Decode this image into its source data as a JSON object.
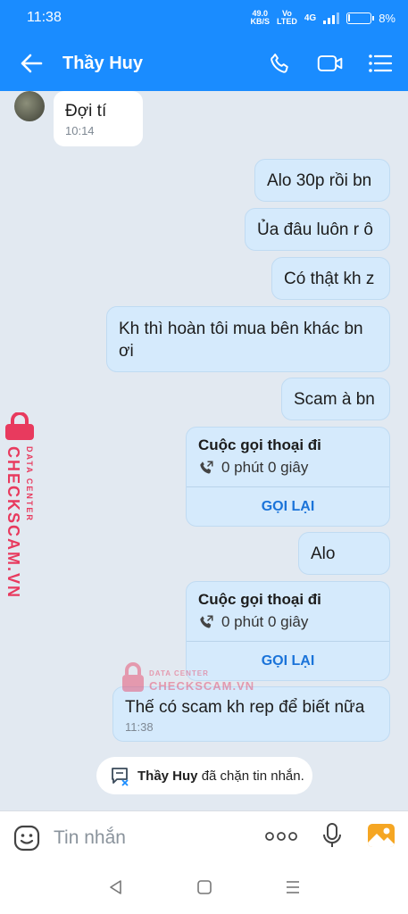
{
  "status_bar": {
    "time": "11:38",
    "speed_value": "49.0",
    "speed_unit": "KB/S",
    "net_top": "Vo",
    "net_bottom": "LTED",
    "network_type": "4G",
    "battery": "8%",
    "battery_level": 0.08
  },
  "header": {
    "title": "Thầy Huy",
    "back_icon": "arrow-left-icon",
    "actions": [
      "phone-icon",
      "video-call-icon",
      "menu-icon"
    ]
  },
  "messages": [
    {
      "id": "m1",
      "direction": "incoming",
      "text": "Đợi tí",
      "time": "10:14"
    },
    {
      "id": "m2",
      "direction": "outgoing",
      "text": "Alo 30p rồi bn"
    },
    {
      "id": "m3",
      "direction": "outgoing",
      "text": "Ủa đâu luôn r ô"
    },
    {
      "id": "m4",
      "direction": "outgoing",
      "text": "Có thật kh z"
    },
    {
      "id": "m5",
      "direction": "outgoing",
      "text": "Kh thì hoàn tôi mua bên khác bn ơi"
    },
    {
      "id": "m6",
      "direction": "outgoing",
      "text": "Scam à bn"
    },
    {
      "id": "m7",
      "direction": "outgoing",
      "type": "call",
      "title": "Cuộc gọi thoại đi",
      "duration": "0 phút 0 giây",
      "action": "GỌI LẠI"
    },
    {
      "id": "m8",
      "direction": "outgoing",
      "text": "Alo"
    },
    {
      "id": "m9",
      "direction": "outgoing",
      "type": "call",
      "title": "Cuộc gọi thoại đi",
      "duration": "0 phút 0 giây",
      "action": "GỌI LẠI"
    },
    {
      "id": "m10",
      "direction": "outgoing",
      "text": "Thế có scam kh rep để biết nữa",
      "time": "11:38"
    }
  ],
  "system_notice": {
    "name": "Thầy Huy",
    "text": "đã chặn tin nhắn."
  },
  "watermark": {
    "top": "DATA CENTER",
    "brand": "CHECKSCAM.VN",
    "color": "#e83a5e"
  },
  "input_bar": {
    "placeholder": "Tin nhắn",
    "icons": [
      "emoji-icon",
      "more-icon",
      "microphone-icon",
      "image-icon"
    ]
  },
  "colors": {
    "accent": "#1a8cff",
    "outgoing_bubble": "#d5eafc",
    "incoming_bubble": "#ffffff",
    "background": "#e2e9f1",
    "recall_link": "#1a73d9"
  }
}
